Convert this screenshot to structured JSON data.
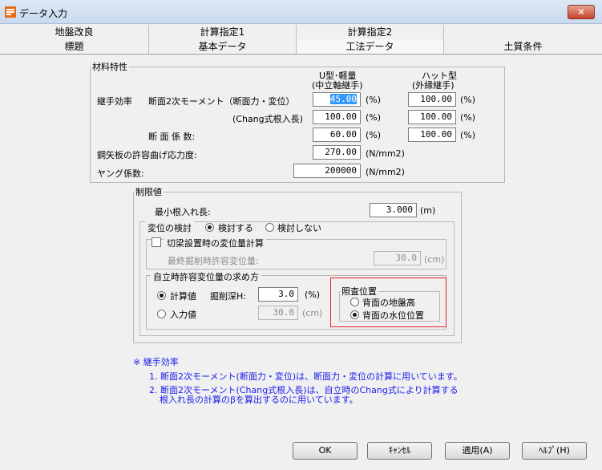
{
  "window": {
    "title": "データ入力",
    "close_glyph": "✕"
  },
  "tabs_row1": [
    "地盤改良",
    "計算指定1",
    "計算指定2",
    ""
  ],
  "tabs_row2": [
    "標題",
    "基本データ",
    "工法データ",
    "土質条件"
  ],
  "material": {
    "legend": "材料特性",
    "col_u": "U型･軽量",
    "col_u_sub": "(中立軸継手)",
    "col_hat": "ハット型",
    "col_hat_sub": "(外縁継手)",
    "joint_eff_label": "継手効率",
    "moment_label": "断面2次モーメント（断面力・変位）",
    "moment_u": "45.00",
    "moment_hat": "100.00",
    "chang_label": "(Chang式根入長)",
    "chang_u": "100.00",
    "chang_hat": "100.00",
    "section_label": "断 面 係 数:",
    "section_u": "60.00",
    "section_hat": "100.00",
    "pct": "(%)",
    "allow_stress_label": "鋼矢板の許容曲げ応力度:",
    "allow_stress_value": "270.00",
    "young_label": "ヤング係数:",
    "young_value": "200000",
    "unit_stress": "(N/mm2)"
  },
  "limit": {
    "legend": "制限値",
    "min_embed_label": "最小根入れ長:",
    "min_embed_value": "3.000",
    "min_embed_unit": "(m)",
    "disp_check_label": "変位の検討",
    "disp_check_yes": "検討する",
    "disp_check_no": "検討しない",
    "strut_check_label": "切梁設置時の変位量計算",
    "final_excav_label": "最終掘削時許容変位量:",
    "final_excav_value": "30.0",
    "unit_cm": "(cm)",
    "self_legend": "自立時許容変位量の求め方",
    "calc_label": "計算値",
    "excav_depth_label": "掘削深H:",
    "excav_depth_value": "3.0",
    "excav_depth_unit": "(%)",
    "input_label": "入力値",
    "input_value": "30.0"
  },
  "check_pos": {
    "legend": "照査位置",
    "option_ground": "背面の地盤高",
    "option_water": "背面の水位位置"
  },
  "notes": {
    "head": "※ 継手効率",
    "line1": "1. 断面2次モーメント(断面力・変位)は、断面力・変位の計算に用いています。",
    "line2": "2. 断面2次モーメント(Chang式根入長)は、自立時のChang式により計算する",
    "line3": "根入れ長の計算のβを算出するのに用いています。"
  },
  "buttons": {
    "ok": "OK",
    "cancel": "ｷｬﾝｾﾙ",
    "apply": "適用(A)",
    "help": "ﾍﾙﾌﾟ(H)"
  }
}
